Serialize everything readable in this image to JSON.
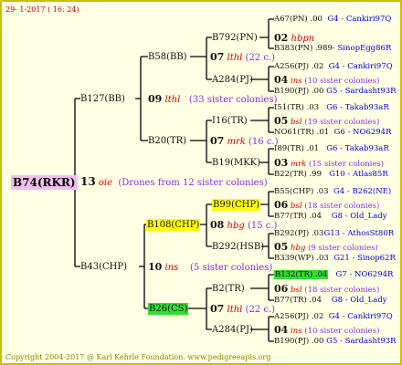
{
  "header": {
    "date": "29- 1-2017 ( 16: 24)"
  },
  "footer": {
    "copyright": "Copyright 2004-2017 @ Karl Kehrle Foundation.   www.pedigreeapis.org"
  },
  "root": {
    "id": "B74(RKR)",
    "gen": "13",
    "breeder": "oie",
    "note": "(Drones from 12 sister colonies)"
  },
  "left": {
    "b127": "B127(BB)",
    "b127_gen": "09",
    "b127_breeder": "lthl",
    "b127_note": "(33 sister colonies)",
    "b43": "B43(CHP)",
    "b43_gen": "10",
    "b43_breeder": "ins",
    "b43_note": "(5 sister colonies)"
  },
  "mid": {
    "b58": "B58(BB)",
    "b58_gen": "07",
    "b58_breeder": "lthl",
    "b58_note": "(22 c.)",
    "b20": "B20(TR)",
    "b20_gen": "07",
    "b20_breeder": "mrk",
    "b20_note": "(16 c.)",
    "b108": "B108(CHP)",
    "b108_gen": "08",
    "b108_breeder": "hbg",
    "b108_note": "(15 c.)",
    "b26": "B26(CS)",
    "b26_gen": "07",
    "b26_breeder": "lthl",
    "b26_note": "(22 c.)"
  },
  "third": {
    "b792": "B792(PN)",
    "b792_gen": "02",
    "b792_breeder": "hbpn",
    "a284a": "A284(PJ)",
    "a284a_gen": "04",
    "a284a_breeder": "ins",
    "a284a_note": "(10 sister colonies)",
    "i16": "I16(TR)",
    "i16_gen": "05",
    "i16_breeder": "bsl",
    "i16_note": "(19 sister colonies)",
    "b19": "B19(MKK)",
    "b19_gen": "03",
    "b19_breeder": "mrk",
    "b19_note": "(15 sister colonies)",
    "b99": "B99(CHP)",
    "b99_gen": "06",
    "b99_breeder": "bsl",
    "b99_note": "(18 sister colonies)",
    "b292": "B292(HSB)",
    "b292_gen": "05",
    "b292_breeder": "hbg",
    "b292_note": "(9 sister colonies)",
    "b2": "B2(TR)",
    "b2_gen": "06",
    "b2_breeder": "bsl",
    "b2_note": "(18 sister colonies)",
    "a284b": "A284(PJ)",
    "a284b_gen": "04",
    "a284b_breeder": "ins",
    "a284b_note": "(10 sister colonies)"
  },
  "leaves": {
    "a67": "A67(PN) .00",
    "a67_r": "G4 - Cankiri97Q",
    "b383": "B383(PN) .989",
    "b383_r": "- SinopEgg86R",
    "a256a": "A256(PJ) .02",
    "a256a_r": "G4 - Cankiri97Q",
    "b190a": "B190(PJ) .00",
    "b190a_r": "G5 - Sardasht93R",
    "i51": "I51(TR) .03",
    "i51_r": "G6 - Takab93aR",
    "no61": "NO61(TR) .01",
    "no61_r": "G6 - NO6294R",
    "i89": "I89(TR) .01",
    "i89_r": "G6 - Takab93aR",
    "b22": "B22(TR) .99",
    "b22_r": "G10 - Atlas85R",
    "b55": "B55(CHP) .03",
    "b55_r": "G4 - B262(NE)",
    "b77a": "B77(TR) .04",
    "b77a_r": "G8 - Old_Lady",
    "b292l": "B292(PJ) .03",
    "b292l_r": "G13 - AthosSt80R",
    "b339": "B339(WP) .03",
    "b339_r": "G21 - Sinop62R",
    "b132": "B132(TR) .04",
    "b132_r": "G7 - NO6294R",
    "b77b": "B77(TR) .04",
    "b77b_r": "G8 - Old_Lady",
    "a256b": "A256(PJ) .02",
    "a256b_r": "G4 - Cankiri97Q",
    "b190b": "B190(PJ) .00",
    "b190b_r": "G5 - Sardasht93R"
  }
}
